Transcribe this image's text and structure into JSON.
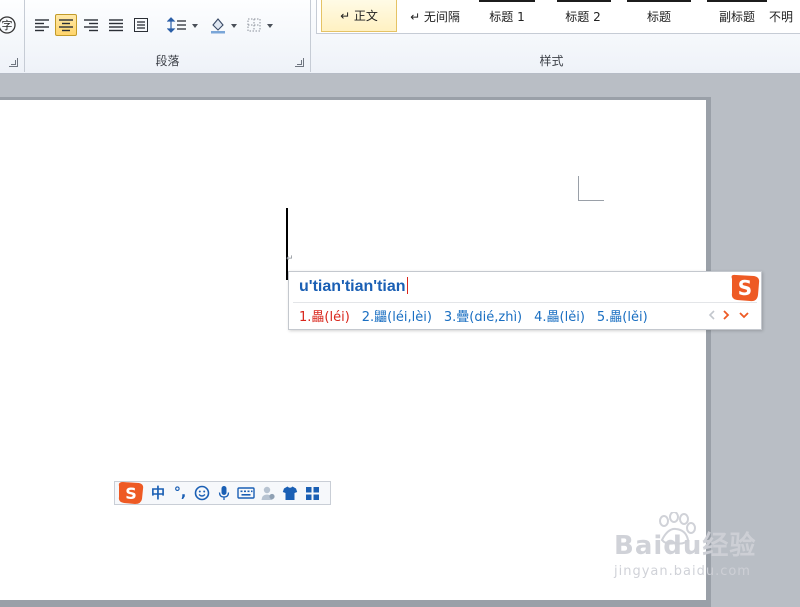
{
  "ribbon": {
    "paragraph_group": {
      "label": "段落",
      "partial_icon_glyph": "字",
      "buttons": [
        "align-left",
        "align-center",
        "align-right",
        "justify",
        "distributed",
        "line-spacing",
        "shading",
        "borders"
      ],
      "active_button": "align-center"
    },
    "styles_group": {
      "label": "样式",
      "items": [
        {
          "label": "↵ 正文",
          "selected": true
        },
        {
          "label": "↵ 无间隔"
        },
        {
          "label": "标题 1"
        },
        {
          "label": "标题 2"
        },
        {
          "label": "标题"
        },
        {
          "label": "副标题"
        },
        {
          "label": "不明"
        }
      ]
    }
  },
  "document": {
    "paragraph_mark": "↵"
  },
  "ime_candidate": {
    "input_text": "u'tian'tian'tian",
    "candidates": [
      "1.畾(léi)",
      "2.鼺(léi,lèi)",
      "3.疊(dié,zhì)",
      "4.畾(lěi)",
      "5.畾(lěi)"
    ],
    "first_color": "#d9261c",
    "other_color": "#1a6fc2"
  },
  "ime_statusbar": {
    "mode_label": "中",
    "punct_label": "°,",
    "icons": [
      "smiley-icon",
      "microphone-icon",
      "keyboard-icon",
      "user-icon",
      "shirt-icon",
      "apps-grid-icon"
    ]
  },
  "watermark": {
    "title": "Baidu经验",
    "sub": "jingyan.baidu.com"
  },
  "colors": {
    "accent_blue": "#1a5fb4",
    "sogou_orange": "#ee5a24"
  }
}
